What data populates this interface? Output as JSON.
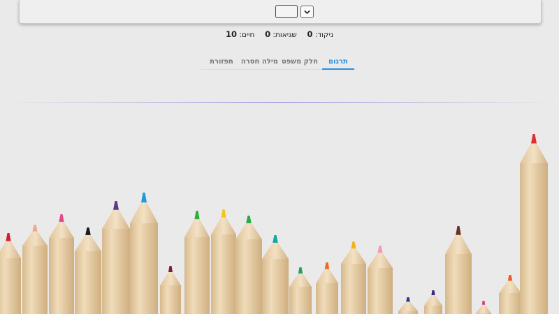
{
  "stats": {
    "score_label": "ניקוד:",
    "score_value": "0",
    "errors_label": "שגיאות:",
    "errors_value": "0",
    "lives_label": "חיים:",
    "lives_value": "10"
  },
  "tabs": [
    {
      "label": "תרגום",
      "active": true
    },
    {
      "label": "חלק משפט",
      "active": false
    },
    {
      "label": "מילה חסרה",
      "active": false
    },
    {
      "label": "תפזורת",
      "active": false
    }
  ],
  "toolbar": {
    "dropdown_icon": "chevron-down-icon"
  },
  "colors": {
    "accent": "#2a8fe0",
    "background": "#ebeaeb"
  }
}
